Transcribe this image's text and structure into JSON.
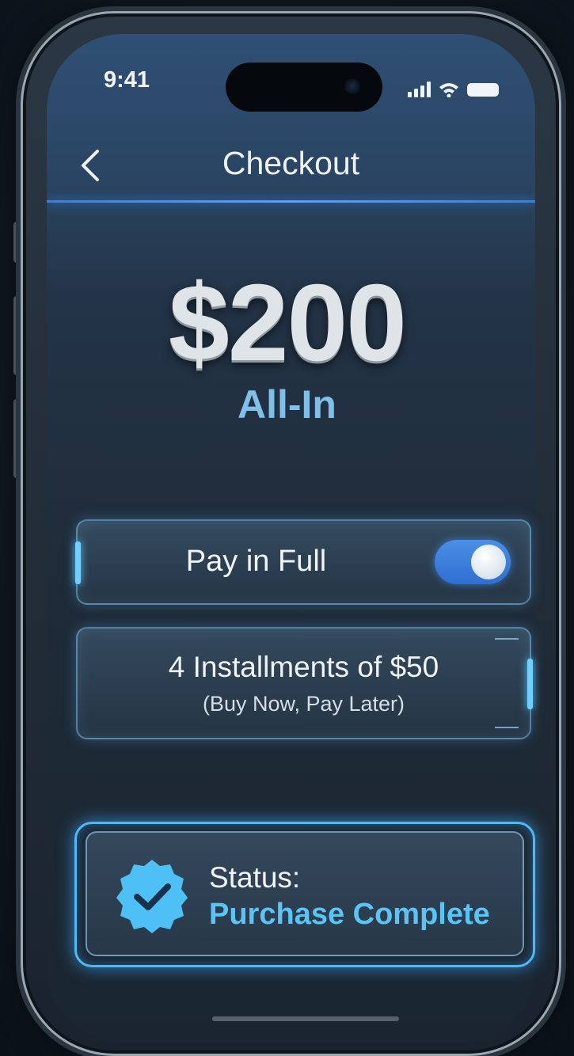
{
  "status_bar": {
    "time": "9:41"
  },
  "nav": {
    "title": "Checkout",
    "back_icon": "chevron-left-icon"
  },
  "summary": {
    "price": "$200",
    "subtitle": "All-In"
  },
  "options": {
    "pay_in_full": {
      "label": "Pay in Full",
      "toggle_on": true
    },
    "installments": {
      "label": "4 Installments of $50",
      "sublabel": "(Buy Now, Pay Later)"
    }
  },
  "status": {
    "label": "Status:",
    "value": "Purchase Complete",
    "icon": "verified-check-badge-icon"
  },
  "colors": {
    "accent": "#4fb9f5",
    "toggle": "#3b7ddc",
    "status_text": "#5ac4f7"
  }
}
